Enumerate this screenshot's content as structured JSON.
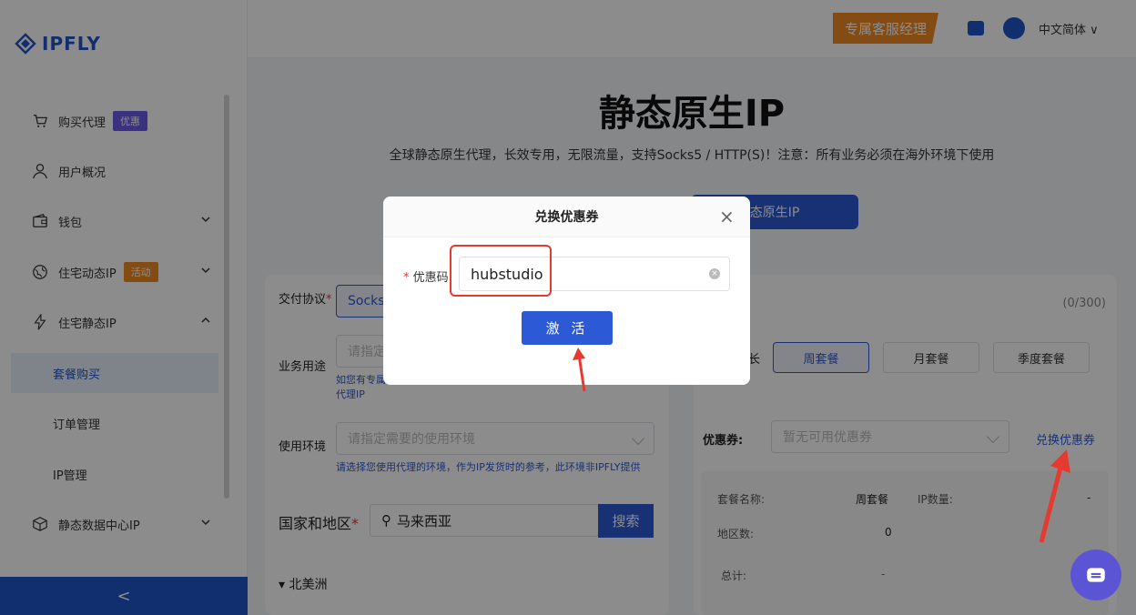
{
  "brand": {
    "name": "IPFLY"
  },
  "sidebar": {
    "items": [
      {
        "label": "购买代理",
        "badge": "优惠",
        "icon": "cart-icon"
      },
      {
        "label": "用户概况",
        "icon": "user-icon"
      },
      {
        "label": "钱包",
        "icon": "wallet-icon"
      },
      {
        "label": "住宅动态IP",
        "badge": "活动",
        "icon": "globe-icon"
      },
      {
        "label": "住宅静态IP",
        "icon": "bolt-icon"
      },
      {
        "label": "套餐购买"
      },
      {
        "label": "订单管理"
      },
      {
        "label": "IP管理"
      },
      {
        "label": "静态数据中心IP",
        "icon": "cube-icon"
      }
    ],
    "collapse_glyph": "<"
  },
  "header": {
    "service_manager": "专属客服经理",
    "language": "中文简体"
  },
  "hero": {
    "title": "静态原生IP",
    "subtitle": "全球静态原生代理，长效专用，无限流量，支持Socks5 / HTTP(S)！注意：所有业务必须在海外环境下使用",
    "tab_partial": "态原生IP"
  },
  "form": {
    "protocol_label": "交付协议",
    "protocol_value": "Socks5",
    "usage_label": "业务用途",
    "usage_placeholder": "请指定",
    "usage_hint": "如您有专属",
    "usage_hint2": "代理IP",
    "env_label": "使用环境",
    "env_placeholder": "请指定需要的使用环境",
    "env_hint": "请选择您使用代理的环境，作为IP发货时的参考，此环境非IPFLY提供",
    "region_label": "国家和地区",
    "search_value": "马来西亚",
    "search_button": "搜索",
    "continent": "北美洲"
  },
  "right_panel": {
    "count": "(0/300)",
    "duration_partial": "长",
    "packages": [
      "周套餐",
      "月套餐",
      "季度套餐"
    ],
    "selected_package": "周套餐",
    "coupon_label": "优惠券:",
    "coupon_placeholder": "暂无可用优惠券",
    "redeem_link": "兑换优惠券",
    "summary": {
      "name_label": "套餐名称:",
      "name_value": "周套餐",
      "ip_count_label": "IP数量:",
      "ip_count_value": "-",
      "regions_label": "地区数:",
      "regions_value": "0",
      "total_label": "总计:",
      "total_value": "-"
    }
  },
  "modal": {
    "title": "兑换优惠券",
    "code_label": "优惠码",
    "code_value": "hubstudio",
    "activate_button": "激 活"
  },
  "colors": {
    "primary": "#2c5ad6",
    "accent": "#f08a24",
    "highlight": "#e53a2f"
  }
}
